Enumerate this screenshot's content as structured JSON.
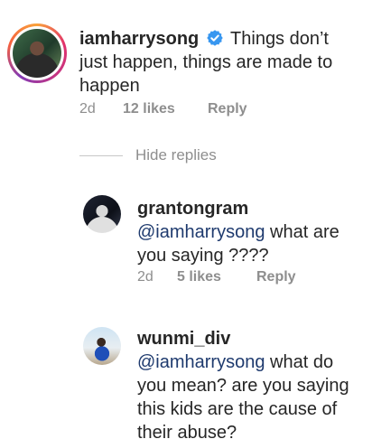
{
  "main_comment": {
    "username": "iamharrysong",
    "verified": true,
    "text": "Things don’t just happen, things are made to happen",
    "time": "2d",
    "likes": "12 likes",
    "reply_label": "Reply"
  },
  "hide_replies_label": "Hide replies",
  "replies": [
    {
      "username": "grantongram",
      "mention": "@iamharrysong",
      "text": "what are you saying ????",
      "time": "2d",
      "likes": "5 likes",
      "reply_label": "Reply"
    },
    {
      "username": "wunmi_div",
      "mention": "@iamharrysong",
      "text": "what do you mean? are you saying this kids are the cause of their abuse?"
    }
  ],
  "colors": {
    "mention": "#1e3a6e",
    "verified_badge": "#3897f0",
    "meta_text": "#8e8e8e"
  },
  "icons": {
    "verified": "verified-badge-icon"
  }
}
